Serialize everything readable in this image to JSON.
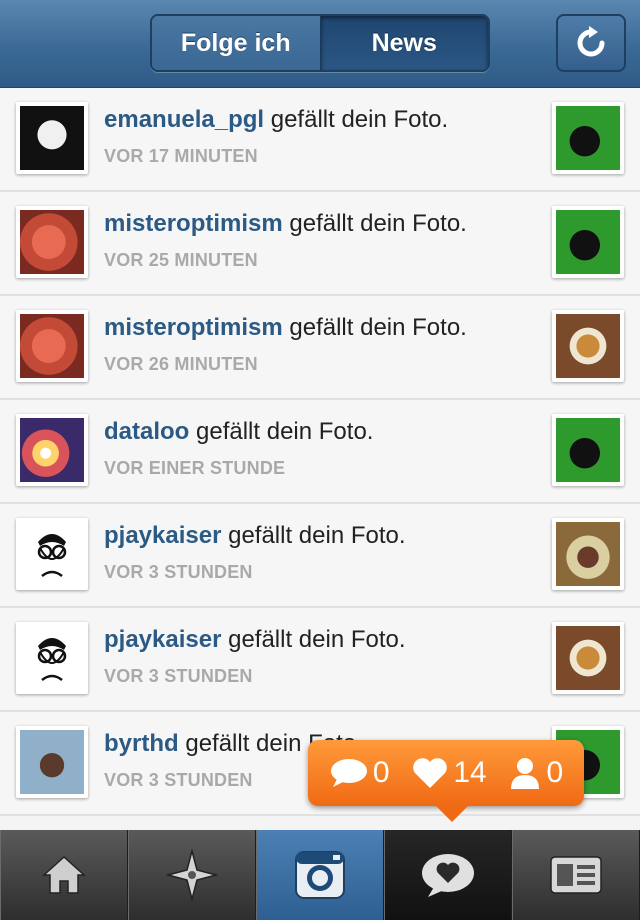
{
  "header": {
    "tabs": [
      {
        "label": "Folge ich",
        "active": false
      },
      {
        "label": "News",
        "active": true
      }
    ],
    "refresh_icon": "refresh-icon"
  },
  "feed": [
    {
      "user": "emanuela_pgl",
      "action": " gefällt dein Foto.",
      "time": "VOR 17 MINUTEN",
      "avatar": "av-face1",
      "thumb": "th-live"
    },
    {
      "user": "misteroptimism",
      "action": " gefällt dein Foto.",
      "time": "VOR 25 MINUTEN",
      "avatar": "av-red",
      "thumb": "th-live"
    },
    {
      "user": "misteroptimism",
      "action": " gefällt dein Foto.",
      "time": "VOR 26 MINUTEN",
      "avatar": "av-red",
      "thumb": "th-food"
    },
    {
      "user": "dataloo",
      "action": " gefällt dein Foto.",
      "time": "VOR EINER STUNDE",
      "avatar": "av-sun",
      "thumb": "th-live"
    },
    {
      "user": "pjaykaiser",
      "action": " gefällt dein Foto.",
      "time": "VOR 3 STUNDEN",
      "avatar": "av-pjk",
      "thumb": "th-food2"
    },
    {
      "user": "pjaykaiser",
      "action": " gefällt dein Foto.",
      "time": "VOR 3 STUNDEN",
      "avatar": "av-pjk",
      "thumb": "th-food"
    },
    {
      "user": "byrthd",
      "action": " gefällt dein Foto.",
      "time": "VOR 3 STUNDEN",
      "avatar": "av-man",
      "thumb": "th-live"
    }
  ],
  "notifications": {
    "comments": "0",
    "likes": "14",
    "followers": "0"
  },
  "tabbar": [
    {
      "name": "tab-home",
      "icon": "home-icon"
    },
    {
      "name": "tab-explore",
      "icon": "explore-icon"
    },
    {
      "name": "tab-camera",
      "icon": "camera-icon"
    },
    {
      "name": "tab-news",
      "icon": "news-heart-icon"
    },
    {
      "name": "tab-profile",
      "icon": "profile-card-icon"
    }
  ],
  "colors": {
    "header": "#3b6a96",
    "username": "#2b5a84",
    "timestamp": "#a9a9a9",
    "badge": "#f06a14"
  }
}
